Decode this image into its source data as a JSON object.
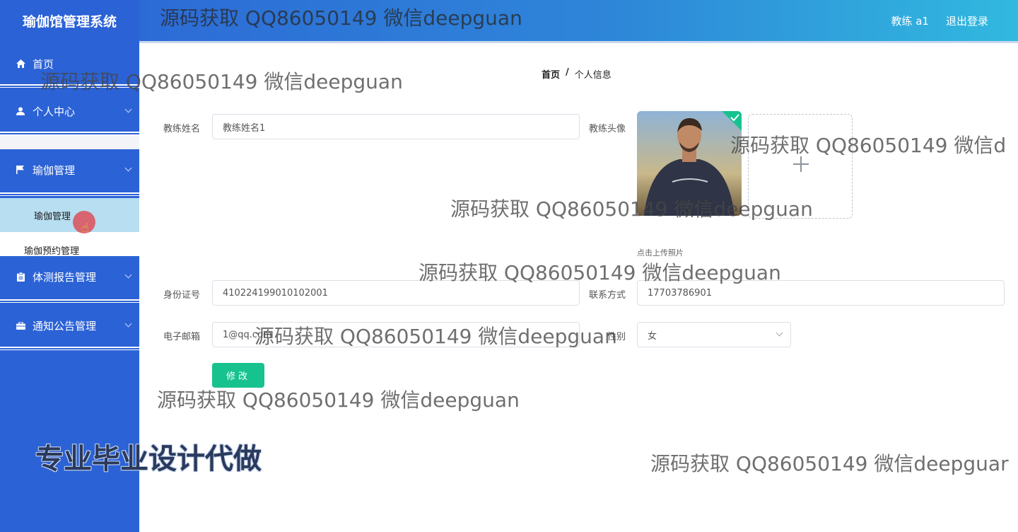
{
  "header": {
    "app_title": "瑜伽馆管理系统",
    "user_label": "教练 a1",
    "logout_label": "退出登录"
  },
  "sidebar": {
    "items": [
      {
        "label": "首页",
        "icon": "home-icon"
      },
      {
        "label": "个人中心",
        "icon": "user-icon"
      },
      {
        "label": "瑜伽管理",
        "icon": "flag-icon"
      },
      {
        "label": "体测报告管理",
        "icon": "clipboard-icon"
      },
      {
        "label": "通知公告管理",
        "icon": "briefcase-icon"
      }
    ],
    "sub_items": [
      {
        "label": "瑜伽管理",
        "active": true
      },
      {
        "label": "瑜伽预约管理",
        "active": false
      }
    ]
  },
  "breadcrumb": {
    "home": "首页",
    "separator": "/",
    "current": "个人信息"
  },
  "form": {
    "name_label": "教练姓名",
    "name_value": "教练姓名1",
    "avatar_label": "教练头像",
    "upload_tip": "点击上传照片",
    "id_label": "身份证号",
    "id_value": "410224199010102001",
    "phone_label": "联系方式",
    "phone_value": "17703786901",
    "email_label": "电子邮箱",
    "email_value": "1@qq.com",
    "gender_label": "性别",
    "gender_value": "女",
    "submit_label": "修改"
  },
  "watermarks": {
    "text": "源码获取 QQ86050149 微信deepguan",
    "text_clipped": "源码获取 QQ86050149 微信d",
    "text_clipped2": "源码获取 QQ86050149 微信deepguar",
    "promo": "专业毕业设计代做"
  },
  "colors": {
    "sidebar": "#2b62d6",
    "active_submenu": "#b7def1",
    "button": "#17c28f"
  }
}
